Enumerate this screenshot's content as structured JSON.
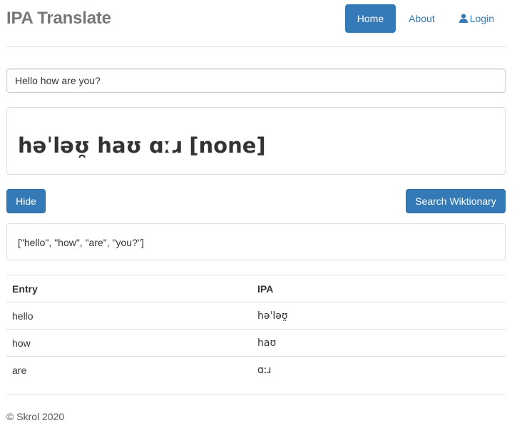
{
  "brand": "IPA Translate",
  "nav": {
    "home": "Home",
    "about": "About",
    "login": "Login"
  },
  "search": {
    "value": "Hello how are you?"
  },
  "result": {
    "ipa": "həˈləʊ̯ haʊ ɑːɹ [none]"
  },
  "buttons": {
    "hide": "Hide",
    "wiktionary": "Search Wiktionary"
  },
  "words": "[\"hello\", \"how\", \"are\", \"you?\"]",
  "table": {
    "headers": [
      "Entry",
      "IPA"
    ],
    "rows": [
      [
        "hello",
        "həˈləʊ̯"
      ],
      [
        "how",
        "haʊ"
      ],
      [
        "are",
        "ɑːɹ"
      ]
    ]
  },
  "footer": "© Skrol 2020",
  "colors": {
    "primary": "#337ab7",
    "brand_text": "#777777",
    "border": "#dddddd"
  },
  "icons": [
    "user-icon"
  ]
}
